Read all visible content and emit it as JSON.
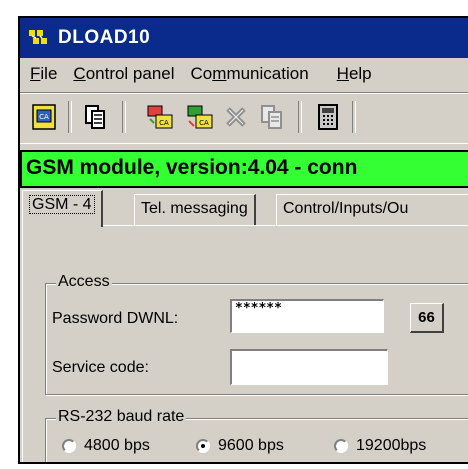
{
  "window": {
    "title": "DLOAD10"
  },
  "menu": {
    "items": [
      {
        "label": "File",
        "accel": "F",
        "rest": "ile"
      },
      {
        "label": "Control panel",
        "accel": "C",
        "rest": "ontrol panel"
      },
      {
        "label": "Communication",
        "pre": "Co",
        "accel": "m",
        "rest": "munication"
      },
      {
        "label": "Help",
        "accel": "H",
        "rest": "elp"
      }
    ]
  },
  "toolbar": {
    "buttons": [
      {
        "name": "open-customer-icon"
      },
      {
        "name": "copy-icon"
      },
      {
        "name": "connect-modem-icon"
      },
      {
        "name": "disconnect-modem-icon"
      },
      {
        "name": "cancel-icon"
      },
      {
        "name": "paste-icon"
      },
      {
        "name": "calculator-icon"
      }
    ]
  },
  "status": {
    "text": "GSM module, version:4.04 -  conn",
    "color": "#33ff33"
  },
  "tabs": [
    {
      "label": "GSM - 4",
      "active": true
    },
    {
      "label": "Tel. messaging",
      "active": false
    },
    {
      "label": "Control/Inputs/Ou",
      "active": false
    }
  ],
  "access": {
    "legend": "Access",
    "password_label": "Password DWNL:",
    "password_value": "******",
    "show_button_label": "66",
    "service_label": "Service code:",
    "service_value": ""
  },
  "baud": {
    "legend": "RS-232 baud rate",
    "options": [
      {
        "label": "4800 bps",
        "selected": false
      },
      {
        "label": "9600 bps",
        "selected": true
      },
      {
        "label": "19200bps",
        "selected": false
      }
    ]
  },
  "colors": {
    "title_bar": "#0a2a8c",
    "status_bg": "#33ff33",
    "face": "#d4d0c8"
  }
}
